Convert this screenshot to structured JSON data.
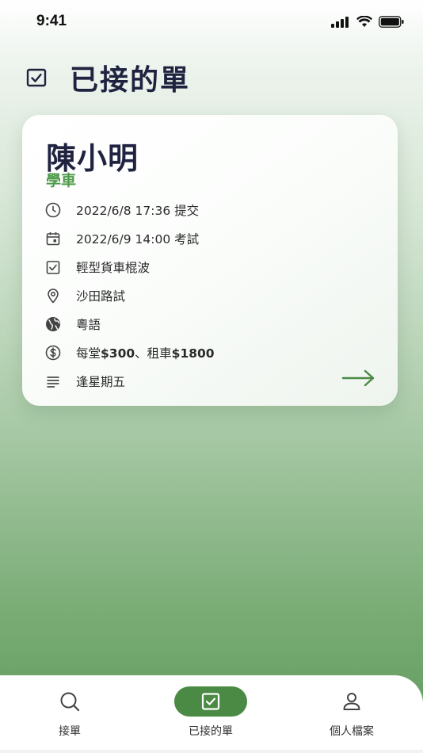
{
  "status_bar": {
    "time": "9:41"
  },
  "header": {
    "title": "已接的單",
    "icon": "checkbox-icon"
  },
  "card": {
    "name": "陳小明",
    "tag": "學車",
    "details": [
      {
        "icon": "clock-icon",
        "text": "2022/6/8  17:36 提交"
      },
      {
        "icon": "calendar-icon",
        "text": "2022/6/9  14:00 考試"
      },
      {
        "icon": "checkbox-icon",
        "text": "輕型貨車棍波"
      },
      {
        "icon": "location-pin-icon",
        "text": "沙田路試"
      },
      {
        "icon": "globe-icon",
        "text": "粵語"
      },
      {
        "icon": "dollar-icon",
        "text_prefix": "每堂",
        "price_lesson": "$300",
        "text_middle": "、租車",
        "price_car": "$1800"
      },
      {
        "icon": "notes-icon",
        "text": "逢星期五"
      }
    ],
    "action_icon": "arrow-right-icon"
  },
  "bottom_nav": {
    "items": [
      {
        "label": "接單",
        "icon": "search-icon",
        "active": false
      },
      {
        "label": "已接的單",
        "icon": "checkbox-icon",
        "active": true
      },
      {
        "label": "個人檔案",
        "icon": "person-icon",
        "active": false
      }
    ]
  },
  "colors": {
    "accent_green": "#4a8a44",
    "tag_green": "#4e9a4a",
    "title_navy": "#1f2340"
  }
}
